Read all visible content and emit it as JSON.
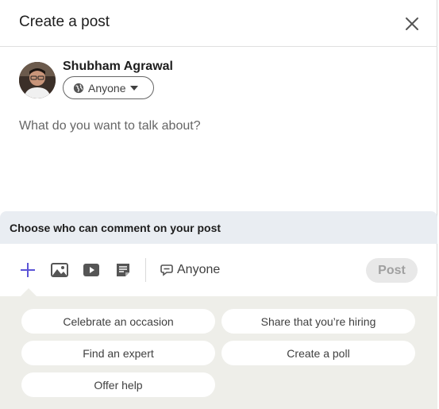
{
  "header": {
    "title": "Create a post",
    "close_icon": "close-icon"
  },
  "author": {
    "name": "Shubham Agrawal",
    "visibility": "Anyone",
    "visibility_icon": "globe-icon"
  },
  "composer": {
    "placeholder": "What do you want to talk about?"
  },
  "comment_prompt": "Choose who can comment on your post",
  "toolbar": {
    "icons": [
      "plus-icon",
      "image-icon",
      "video-icon",
      "document-icon"
    ],
    "comment_setting": "Anyone",
    "post_label": "Post"
  },
  "suggestions": {
    "items": [
      "Celebrate an occasion",
      "Share that you’re hiring",
      "Find an expert",
      "Create a poll",
      "Offer help"
    ]
  },
  "colors": {
    "accent": "#0a66c2",
    "plus": "#5b54d6",
    "suggest_bg": "#eeeee9",
    "comment_bar_bg": "#e9edf2"
  }
}
